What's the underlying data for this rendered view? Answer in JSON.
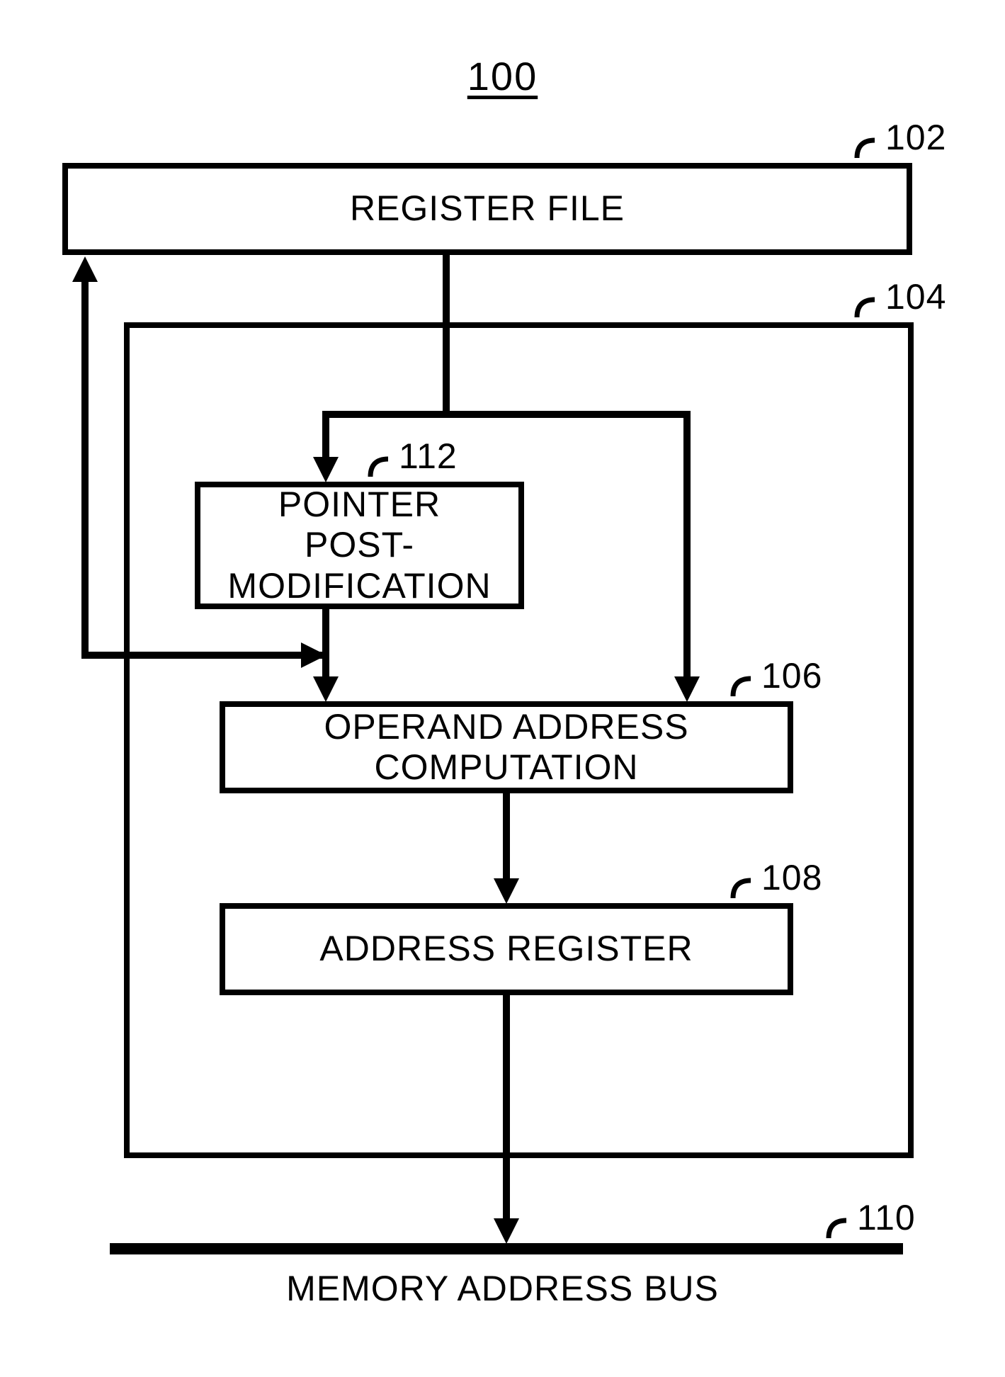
{
  "diagram": {
    "title": "100",
    "blocks": {
      "register_file": {
        "label": "REGISTER FILE",
        "ref": "102"
      },
      "container": {
        "ref": "104"
      },
      "pointer_post_mod": {
        "label_line1": "POINTER",
        "label_line2": "POST-MODIFICATION",
        "ref": "112"
      },
      "operand_addr": {
        "label": "OPERAND ADDRESS COMPUTATION",
        "ref": "106"
      },
      "addr_register": {
        "label": "ADDRESS REGISTER",
        "ref": "108"
      },
      "memory_bus": {
        "label": "MEMORY ADDRESS BUS",
        "ref": "110"
      }
    }
  }
}
